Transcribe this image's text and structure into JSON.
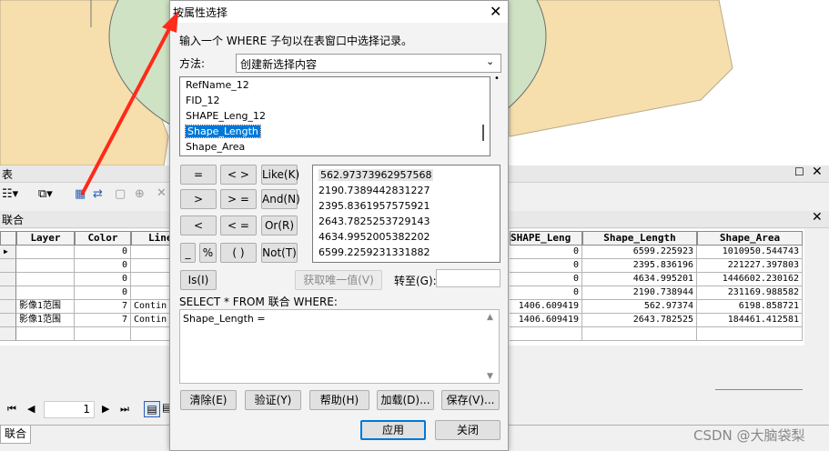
{
  "dialog": {
    "title": "按属性选择",
    "instruction": "输入一个 WHERE 子句以在表窗口中选择记录。",
    "method_label": "方法:",
    "method_value": "创建新选择内容",
    "fields": [
      "RefName_12",
      "FID_12",
      "SHAPE_Leng_12",
      "Shape_Length",
      "Shape_Area"
    ],
    "selected_field": "Shape_Length",
    "operators": [
      "=",
      "< >",
      "Like(K)",
      ">",
      "> =",
      "And(N)",
      "<",
      "< =",
      "Or(R)",
      "_",
      "%",
      "( )",
      "Not(T)"
    ],
    "is_label": "Is(I)",
    "values": [
      "562.97373962957568",
      "2190.7389442831227",
      "2395.8361957575921",
      "2643.7825253729143",
      "4634.9952005382202",
      "6599.2259231331882"
    ],
    "get_unique_label": "获取唯一值(V)",
    "goto_label": "转至(G):",
    "goto_value": "",
    "select_prefix": "SELECT * FROM 联合 WHERE:",
    "expression": "Shape_Length =",
    "buttons": {
      "clear": "清除(E)",
      "verify": "验证(Y)",
      "help": "帮助(H)",
      "load": "加载(D)...",
      "save": "保存(V)...",
      "apply": "应用",
      "close": "关闭"
    },
    "close_icon": "close-icon"
  },
  "table_window": {
    "title": "表",
    "layer_tab": "联合",
    "bottom_tab": "联合",
    "page_number": "1",
    "left_columns": [
      "Layer",
      "Color",
      "Line"
    ],
    "right_columns": [
      "SHAPE_Leng",
      "Shape_Length",
      "Shape_Area"
    ],
    "rows": [
      {
        "layer": "",
        "color": "0",
        "line": "",
        "shape_leng": "0",
        "shape_length": "6599.225923",
        "shape_area": "1010950.544743"
      },
      {
        "layer": "",
        "color": "0",
        "line": "",
        "shape_leng": "0",
        "shape_length": "2395.836196",
        "shape_area": "221227.397803"
      },
      {
        "layer": "",
        "color": "0",
        "line": "",
        "shape_leng": "0",
        "shape_length": "4634.995201",
        "shape_area": "1446602.230162"
      },
      {
        "layer": "",
        "color": "0",
        "line": "",
        "shape_leng": "0",
        "shape_length": "2190.738944",
        "shape_area": "231169.988582"
      },
      {
        "layer": "影像1范围",
        "color": "7",
        "line": "Contin",
        "shape_leng": "1406.609419",
        "shape_length": "562.97374",
        "shape_area": "6198.858721"
      },
      {
        "layer": "影像1范围",
        "color": "7",
        "line": "Contin",
        "shape_leng": "1406.609419",
        "shape_length": "2643.782525",
        "shape_area": "184461.412581"
      }
    ]
  },
  "watermark": "CSDN @大脑袋梨",
  "colors": {
    "arrow": "#ff2a1a",
    "select": "#0078d7",
    "map_green": "#cfe3c4",
    "map_tan": "#f6dfad"
  }
}
